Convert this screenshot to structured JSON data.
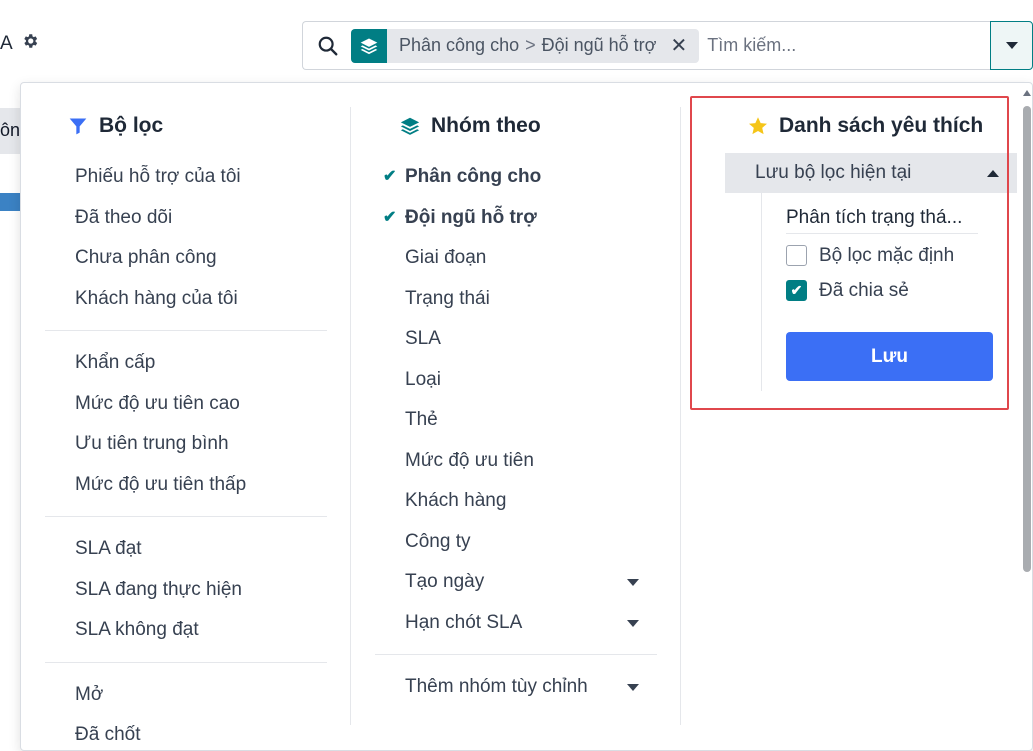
{
  "topbar": {
    "title_fragment": "A"
  },
  "search": {
    "facet": {
      "part1": "Phân công cho",
      "separator": ">",
      "part2": "Đội ngũ hỗ trợ"
    },
    "placeholder": "Tìm kiếm..."
  },
  "background": {
    "fragment": "ông"
  },
  "filters": {
    "title": "Bộ lọc",
    "groups": [
      [
        "Phiếu hỗ trợ của tôi",
        "Đã theo dõi",
        "Chưa phân công",
        "Khách hàng của tôi"
      ],
      [
        "Khẩn cấp",
        "Mức độ ưu tiên cao",
        "Ưu tiên trung bình",
        "Mức độ ưu tiên thấp"
      ],
      [
        "SLA đạt",
        "SLA đang thực hiện",
        "SLA không đạt"
      ],
      [
        "Mở",
        "Đã chốt"
      ]
    ]
  },
  "groupby": {
    "title": "Nhóm theo",
    "items": [
      {
        "label": "Phân công cho",
        "checked": true
      },
      {
        "label": "Đội ngũ hỗ trợ",
        "checked": true
      },
      {
        "label": "Giai đoạn"
      },
      {
        "label": "Trạng thái"
      },
      {
        "label": "SLA"
      },
      {
        "label": "Loại"
      },
      {
        "label": "Thẻ"
      },
      {
        "label": "Mức độ ưu tiên"
      },
      {
        "label": "Khách hàng"
      },
      {
        "label": "Công ty"
      },
      {
        "label": "Tạo ngày",
        "submenu": true
      },
      {
        "label": "Hạn chót SLA",
        "submenu": true
      }
    ],
    "custom_group": "Thêm nhóm tùy chỉnh"
  },
  "favorites": {
    "title": "Danh sách yêu thích",
    "save_current": "Lưu bộ lọc hiện tại",
    "filter_name": "Phân tích trạng thá...",
    "default_filter": {
      "label": "Bộ lọc mặc định",
      "checked": false
    },
    "shared": {
      "label": "Đã chia sẻ",
      "checked": true
    },
    "save_button": "Lưu"
  },
  "colors": {
    "accent": "#017e84",
    "primary_button": "#3b6ff5",
    "highlight": "#e0474c",
    "filter_icon": "#3b6ff5",
    "star": "#f5c518"
  }
}
